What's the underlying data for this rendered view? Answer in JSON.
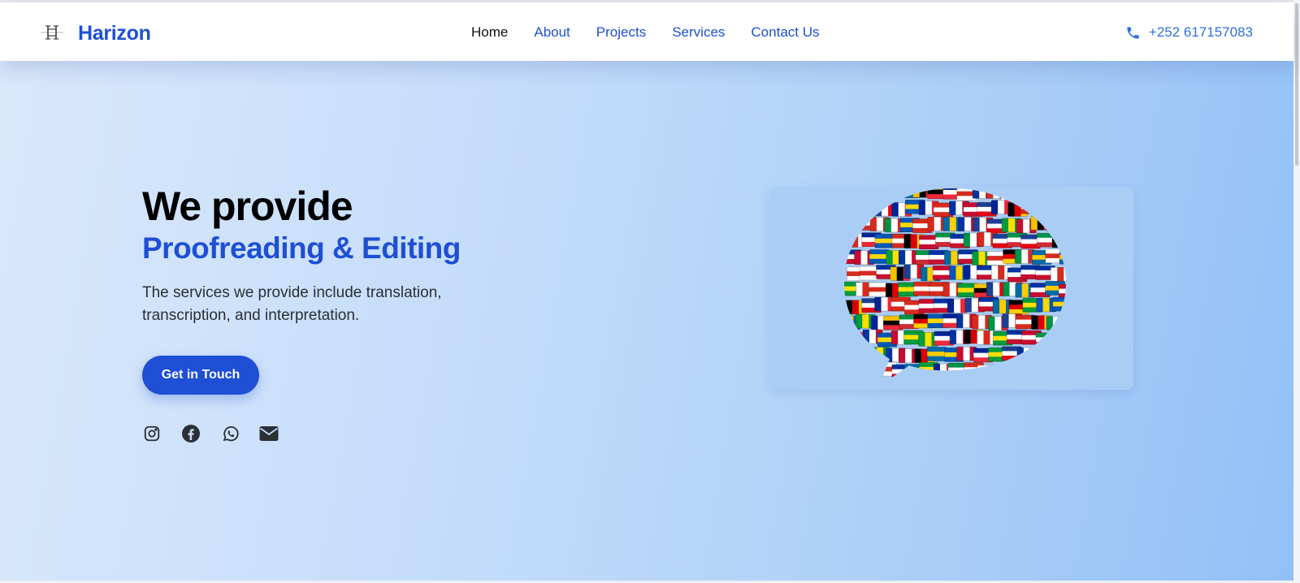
{
  "brand": {
    "name": "Harizon",
    "logo_icon": "h-monogram-icon"
  },
  "nav": {
    "links": [
      {
        "label": "Home",
        "active": true
      },
      {
        "label": "About",
        "active": false
      },
      {
        "label": "Projects",
        "active": false
      },
      {
        "label": "Services",
        "active": false
      },
      {
        "label": "Contact Us",
        "active": false
      }
    ]
  },
  "phone": {
    "icon": "phone-icon",
    "number": "+252 617157083"
  },
  "hero": {
    "title": "We provide",
    "subtitle": "Proofreading & Editing",
    "description": "The services we provide include translation, transcription, and interpretation.",
    "cta_label": "Get in Touch",
    "socials": [
      "instagram-icon",
      "facebook-icon",
      "whatsapp-icon",
      "email-icon"
    ],
    "image_icon": "flags-speech-bubble-icon"
  },
  "colors": {
    "accent": "#1e4fd4",
    "phone_text": "#2f6fe0",
    "hero_gradient_start": "#d9e8fb",
    "hero_gradient_end": "#92c0f6",
    "text_dark": "#000000"
  }
}
